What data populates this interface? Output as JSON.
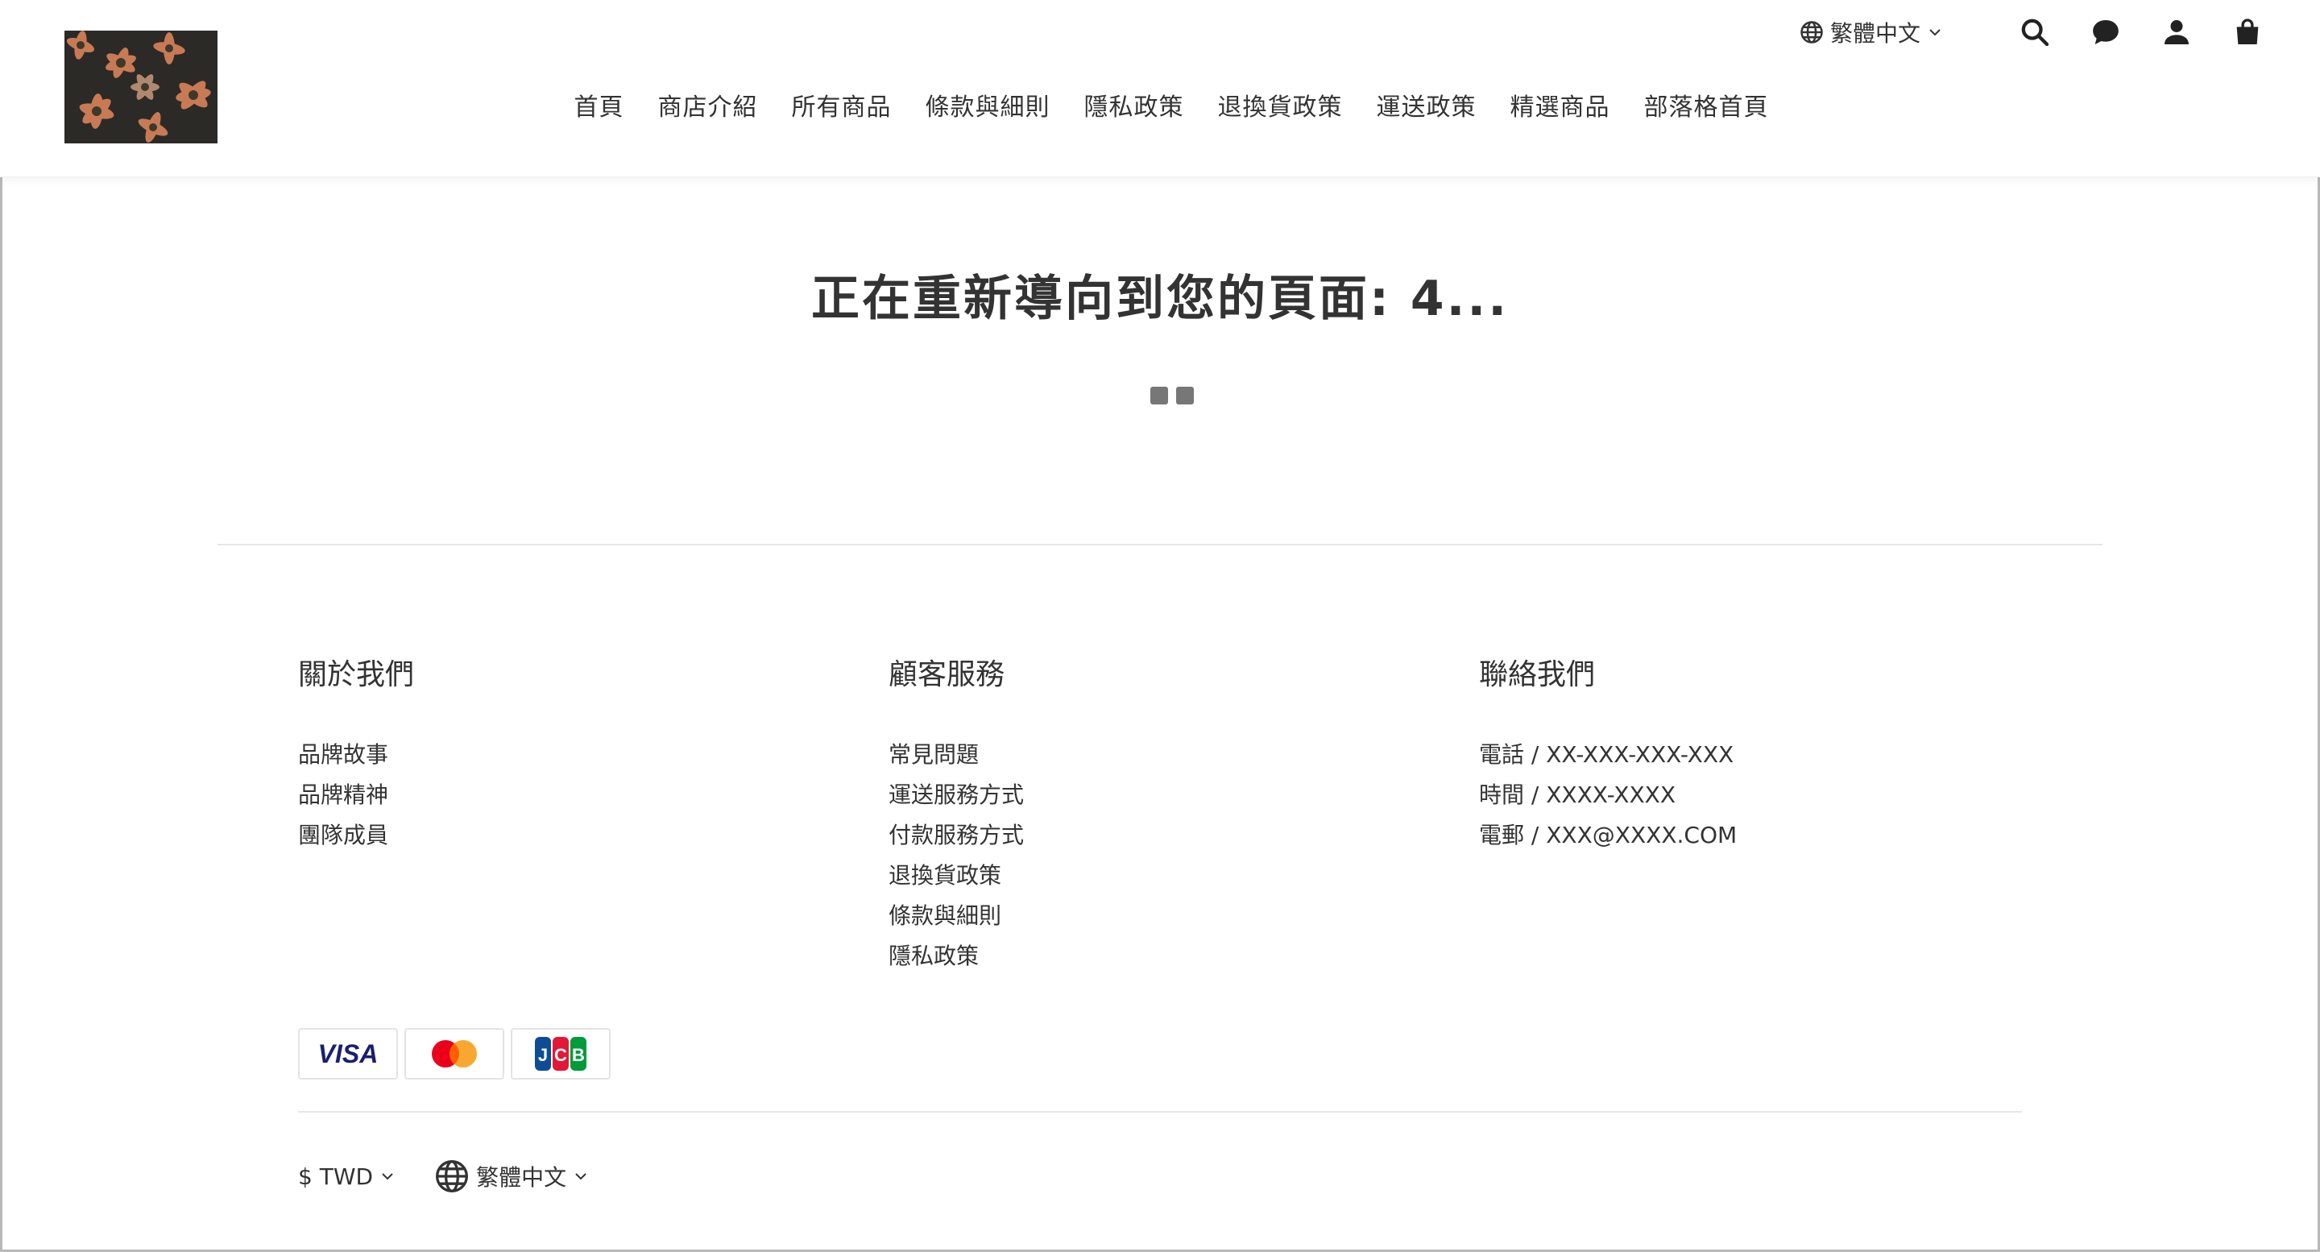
{
  "header": {
    "language": "繁體中文",
    "icons": [
      "globe-icon",
      "search-icon",
      "chat-icon",
      "user-icon",
      "cart-icon"
    ]
  },
  "nav": {
    "items": [
      "首頁",
      "商店介紹",
      "所有商品",
      "條款與細則",
      "隱私政策",
      "退換貨政策",
      "運送政策",
      "精選商品",
      "部落格首頁"
    ]
  },
  "main": {
    "redirect_text": "正在重新導向到您的頁面: 4..."
  },
  "footer": {
    "about": {
      "heading": "關於我們",
      "links": [
        "品牌故事",
        "品牌精神",
        "團隊成員"
      ]
    },
    "service": {
      "heading": "顧客服務",
      "links": [
        "常見問題",
        "運送服務方式",
        "付款服務方式",
        "退換貨政策",
        "條款與細則",
        "隱私政策"
      ]
    },
    "contact": {
      "heading": "聯絡我們",
      "lines": [
        "電話 / XX-XXX-XXX-XXX",
        "時間 / XXXX-XXXX",
        "電郵 / XXX@XXXX.COM"
      ]
    },
    "payments": [
      "VISA",
      "Mastercard",
      "JCB"
    ],
    "currency": "$ TWD",
    "language": "繁體中文"
  },
  "colors": {
    "text": "#333333",
    "divider": "#e6e6e6",
    "visa": "#1a1f71",
    "mc_red": "#eb001b",
    "mc_yellow": "#f79e1b",
    "jcb_blue": "#0e4c96",
    "jcb_red": "#e21836",
    "jcb_green": "#009b3a"
  }
}
